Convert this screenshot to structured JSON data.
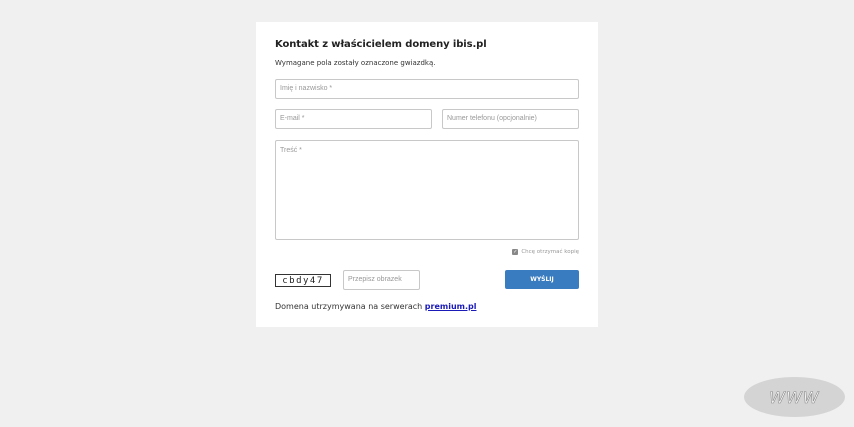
{
  "form": {
    "title": "Kontakt z właścicielem domeny ibis.pl",
    "subtitle": "Wymagane pola zostały oznaczone gwiazdką.",
    "name_placeholder": "Imię i nazwisko *",
    "email_placeholder": "E-mail *",
    "phone_placeholder": "Numer telefonu (opcjonalnie)",
    "message_placeholder": "Treść *",
    "copy_checkbox": {
      "label": "Chcę otrzymać kopię",
      "checked": true
    },
    "captcha_text": "cbdy47",
    "captcha_input_placeholder": "Przepisz obrazek",
    "send_label": "WYŚLIJ"
  },
  "footer": {
    "text": "Domena utrzymywana na serwerach",
    "link_text": "premium.pl"
  },
  "badge": {
    "text": "WWW"
  }
}
